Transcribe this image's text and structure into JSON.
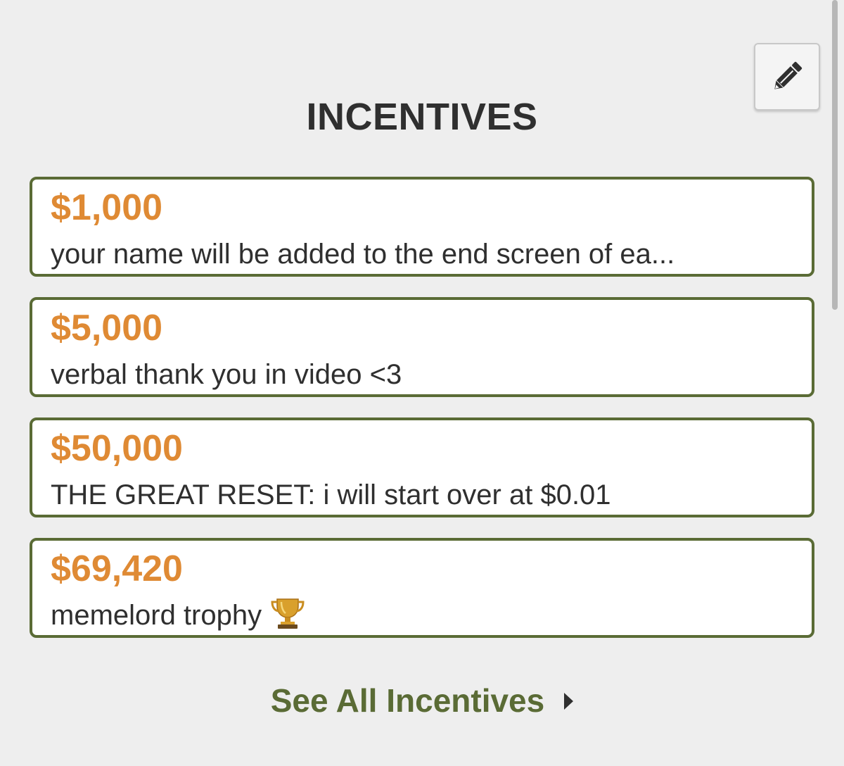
{
  "header": {
    "title": "INCENTIVES",
    "edit_icon": "pencil-icon"
  },
  "incentives": [
    {
      "amount": "$1,000",
      "description": "your name will be added to the end screen of ea..."
    },
    {
      "amount": "$5,000",
      "description": "verbal thank you in video <3"
    },
    {
      "amount": "$50,000",
      "description": "THE GREAT RESET: i will start over at $0.01"
    },
    {
      "amount": "$69,420",
      "description": "memelord trophy",
      "emoji_icon": "trophy-icon"
    }
  ],
  "footer": {
    "see_all_label": "See All Incentives",
    "see_all_icon": "caret-right-icon"
  },
  "colors": {
    "background": "#eeeeee",
    "amount": "#df8a34",
    "card_border": "#5a6b35",
    "link": "#5a6b35",
    "text": "#2f2f2f"
  }
}
